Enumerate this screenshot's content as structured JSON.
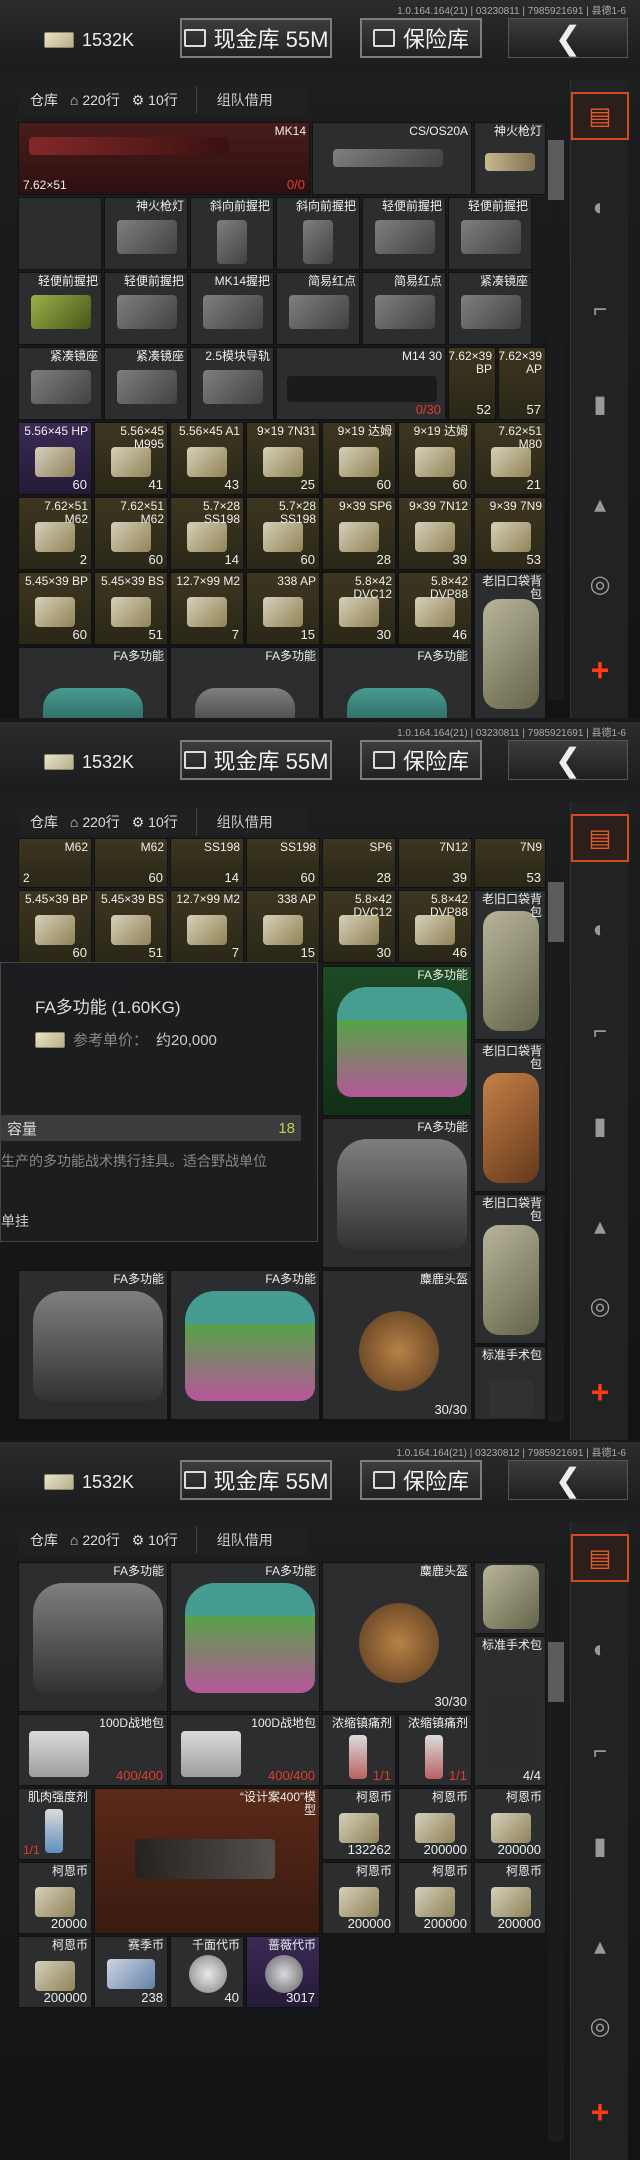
{
  "header": {
    "version": "1.0.164.164(21) | 03230811 | 7985921691 | 县德1-6",
    "version_p3": "1.0.164.164(21) | 03230812 | 7985921691 | 县德1-6",
    "money": "1532K",
    "cash_vault": "现金库 55M",
    "safe": "保险库",
    "back": "❮"
  },
  "storage_bar": {
    "warehouse": "仓库",
    "rows": "220行",
    "rows2": "10行",
    "team_borrow": "组队借用"
  },
  "panel1": {
    "row1": [
      {
        "name": "MK14",
        "bl": "7.62×51",
        "ct": "0/0"
      },
      {
        "name": "CS/OS20A"
      },
      {
        "name": "神火枪灯"
      }
    ],
    "row2": [
      "神火枪灯",
      "斜向前握把",
      "斜向前握把",
      "轻便前握把",
      "轻便前握把",
      "",
      ""
    ],
    "row3": [
      "轻便前握把",
      "轻便前握把",
      "MK14握把",
      "简易红点",
      "简易红点",
      "简易红点",
      "紧凑镜座"
    ],
    "row4": [
      {
        "name": "紧凑镜座"
      },
      {
        "name": "紧凑镜座"
      },
      {
        "name": "2.5模块导轨"
      },
      {
        "name": "M14 30",
        "ct": "0/30"
      },
      {
        "name": "7.62×39 BP",
        "ct": "52"
      },
      {
        "name": "7.62×39 AP",
        "ct": "57"
      }
    ],
    "row5": [
      {
        "name": "5.56×45 HP",
        "ct": "60"
      },
      {
        "name": "5.56×45 M995",
        "ct": "41"
      },
      {
        "name": "5.56×45 A1",
        "ct": "43"
      },
      {
        "name": "9×19 7N31",
        "ct": "25"
      },
      {
        "name": "9×19 达姆",
        "ct": "60"
      },
      {
        "name": "9×19 达姆",
        "ct": "60"
      },
      {
        "name": "7.62×51 M80",
        "ct": "21"
      }
    ],
    "row6": [
      {
        "name": "7.62×51 M62",
        "ct": "2"
      },
      {
        "name": "7.62×51 M62",
        "ct": "60"
      },
      {
        "name": "5.7×28 SS198",
        "ct": "14"
      },
      {
        "name": "5.7×28 SS198",
        "ct": "60"
      },
      {
        "name": "9×39 SP6",
        "ct": "28"
      },
      {
        "name": "9×39 7N12",
        "ct": "39"
      },
      {
        "name": "9×39 7N9",
        "ct": "53"
      }
    ],
    "row7": [
      {
        "name": "5.45×39 BP",
        "ct": "60"
      },
      {
        "name": "5.45×39 BS",
        "ct": "51"
      },
      {
        "name": "12.7×99 M2",
        "ct": "7"
      },
      {
        "name": "338 AP",
        "ct": "15"
      },
      {
        "name": "5.8×42 DVC12",
        "ct": "30"
      },
      {
        "name": "5.8×42 DVP88",
        "ct": "46"
      },
      {
        "name": "老旧口袋背包"
      }
    ],
    "row8": [
      "FA多功能",
      "FA多功能",
      "FA多功能"
    ]
  },
  "tooltip": {
    "title": "FA多功能 (1.60KG)",
    "price_label": "参考单价：",
    "price": "约20,000",
    "cap_label": "容量",
    "cap": "18",
    "desc": "生产的多功能战术携行挂具。适合野战单位",
    "slot": "单挂"
  },
  "panel2": {
    "rowA": [
      {
        "name": "M62",
        "ct": "2"
      },
      {
        "name": "M62",
        "ct": "60"
      },
      {
        "name": "SS198",
        "ct": "14"
      },
      {
        "name": "SS198",
        "ct": "60"
      },
      {
        "name": "SP6",
        "ct": "28"
      },
      {
        "name": "7N12",
        "ct": "39"
      },
      {
        "name": "7N9",
        "ct": "53"
      }
    ],
    "rowB": [
      {
        "name": "5.45×39 BP",
        "ct": "60"
      },
      {
        "name": "5.45×39 BS",
        "ct": "51"
      },
      {
        "name": "12.7×99 M2",
        "ct": "7"
      },
      {
        "name": "338 AP",
        "ct": "15"
      },
      {
        "name": "5.8×42 DVC12",
        "ct": "30"
      },
      {
        "name": "5.8×42 DVP88",
        "ct": "46"
      }
    ],
    "bags": [
      "FA多功能",
      "老旧口袋背包",
      "FA多功能",
      "老旧口袋背包",
      "FA多功能",
      "FA多功能"
    ],
    "helmet": {
      "name": "麋鹿头盔",
      "ct": "30/30"
    },
    "pack": "标准手术包"
  },
  "panel3": {
    "row1": [
      {
        "name": "FA多功能"
      },
      {
        "name": "FA多功能"
      },
      {
        "name": "麋鹿头盔",
        "ct": "30/30"
      },
      {
        "name": "标准手术包"
      }
    ],
    "row2": [
      {
        "name": "100D战地包",
        "ct": "400/400"
      },
      {
        "name": "100D战地包",
        "ct": "400/400"
      },
      {
        "name": "浓缩镇痛剂",
        "ct": "1/1"
      },
      {
        "name": "浓缩镇痛剂",
        "ct": "1/1"
      },
      {
        "name": "标准手术包",
        "ct": "4/4"
      }
    ],
    "row3": [
      {
        "name": "肌肉强度剂",
        "ct": "1/1"
      },
      {
        "name": "“设计案400”模型"
      },
      {
        "name": "柯恩币",
        "ct": "132262"
      },
      {
        "name": "柯恩币",
        "ct": "200000"
      },
      {
        "name": "柯恩币",
        "ct": "200000"
      }
    ],
    "row4": [
      {
        "name": "柯恩币",
        "ct": "20000"
      },
      {
        "name": "柯恩币",
        "ct": "200000"
      },
      {
        "name": "柯恩币",
        "ct": "200000"
      },
      {
        "name": "柯恩币",
        "ct": "200000"
      }
    ],
    "row5": [
      {
        "name": "柯恩币",
        "ct": "200000"
      },
      {
        "name": "赛季币",
        "ct": "238"
      },
      {
        "name": "千面代币",
        "ct": "40"
      },
      {
        "name": "蔷薇代币",
        "ct": "3017"
      }
    ]
  },
  "rail_icons": [
    "storage-icon",
    "backpack-icon",
    "helmet-icon",
    "rifle-icon",
    "magazine-icon",
    "bullet-icon",
    "scope-icon",
    "add-icon"
  ],
  "colors": {
    "accent": "#d34a1c",
    "yellow_cell": "#3d3620",
    "red_cell": "#4a1c1c",
    "purple_cell": "#3a2a55"
  }
}
